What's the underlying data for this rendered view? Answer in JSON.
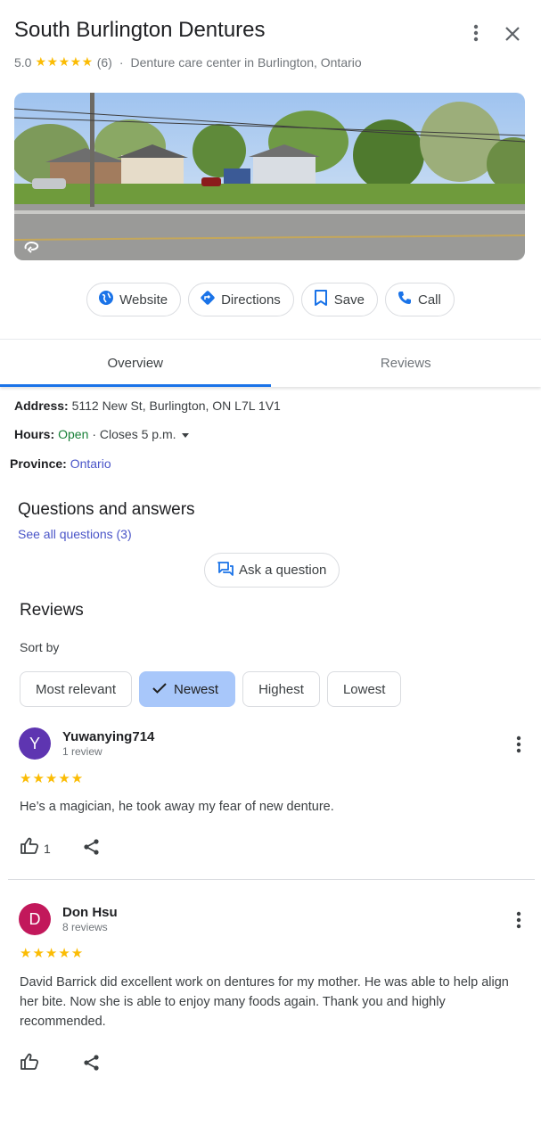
{
  "place": {
    "title": "South Burlington Dentures",
    "rating": "5.0",
    "review_count": "(6)",
    "separator": "·",
    "category": "Denture care center in Burlington, Ontario"
  },
  "actions": {
    "website": "Website",
    "directions": "Directions",
    "save": "Save",
    "call": "Call"
  },
  "tabs": {
    "overview": "Overview",
    "reviews": "Reviews"
  },
  "info": {
    "address_label": "Address:",
    "address_value": "5112 New St, Burlington, ON L7L 1V1",
    "hours_label": "Hours:",
    "hours_status": "Open",
    "hours_rest": "· Closes 5 p.m.",
    "province_label": "Province:",
    "province_value": "Ontario"
  },
  "qa": {
    "title": "Questions and answers",
    "see_all": "See all questions (3)",
    "ask": "Ask a question"
  },
  "reviews": {
    "title": "Reviews",
    "sort_label": "Sort by",
    "sort_options": [
      "Most relevant",
      "Newest",
      "Highest",
      "Lowest"
    ],
    "sort_selected": "Newest",
    "items": [
      {
        "initial": "Y",
        "name": "Yuwanying714",
        "count": "1 review",
        "stars": 5,
        "text": "He’s a magician, he took away my fear of new denture.",
        "likes": "1",
        "avatar_color": "#5e35b1"
      },
      {
        "initial": "D",
        "name": "Don Hsu",
        "count": "8 reviews",
        "stars": 5,
        "text": "David Barrick did excellent work on dentures for my mother. He was able to help align her bite. Now she is able to enjoy many foods again. Thank you and highly recommended.",
        "likes": "",
        "avatar_color": "#c2185b"
      }
    ]
  },
  "colors": {
    "accent": "#1a73e8",
    "star": "#fbbc04",
    "open": "#188038",
    "link": "#4a55c8",
    "selected_chip": "#a8c7fa"
  },
  "icons": [
    "more-vert-icon",
    "close-icon",
    "globe-icon",
    "directions-icon",
    "bookmark-icon",
    "phone-icon",
    "rotate-360-icon",
    "chat-question-icon",
    "check-icon",
    "thumb-up-icon",
    "share-icon",
    "caret-down-icon"
  ]
}
